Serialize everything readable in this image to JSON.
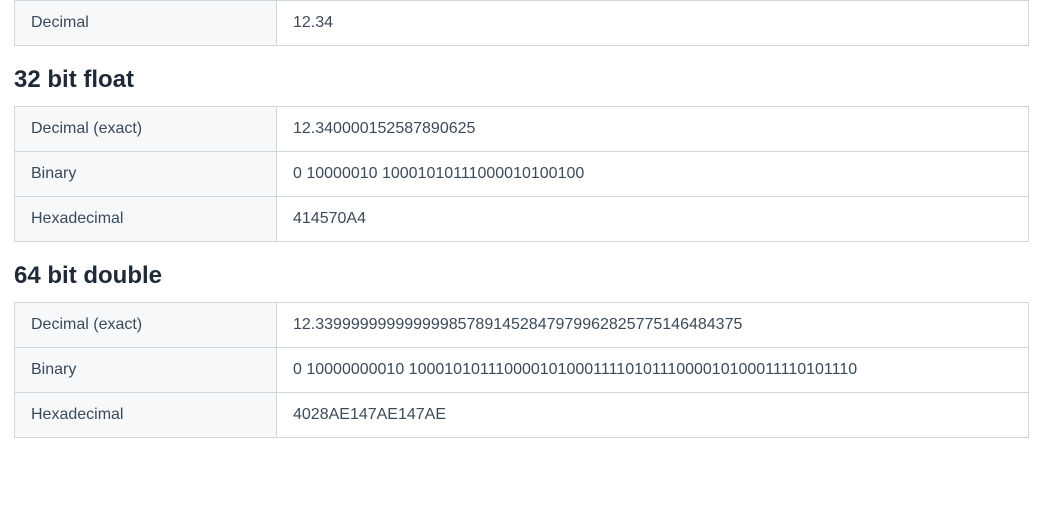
{
  "input": {
    "rows": [
      {
        "label": "Decimal",
        "value": "12.34"
      }
    ]
  },
  "float32": {
    "heading": "32 bit float",
    "rows": [
      {
        "label": "Decimal (exact)",
        "value": "12.340000152587890625"
      },
      {
        "label": "Binary",
        "value": "0 10000010 10001010111000010100100"
      },
      {
        "label": "Hexadecimal",
        "value": "414570A4"
      }
    ]
  },
  "double64": {
    "heading": "64 bit double",
    "rows": [
      {
        "label": "Decimal (exact)",
        "value": "12.339999999999999857891452847979962825775146484375"
      },
      {
        "label": "Binary",
        "value": "0 10000000010 1000101011100001010001111010111000010100011110101110"
      },
      {
        "label": "Hexadecimal",
        "value": "4028AE147AE147AE"
      }
    ]
  }
}
